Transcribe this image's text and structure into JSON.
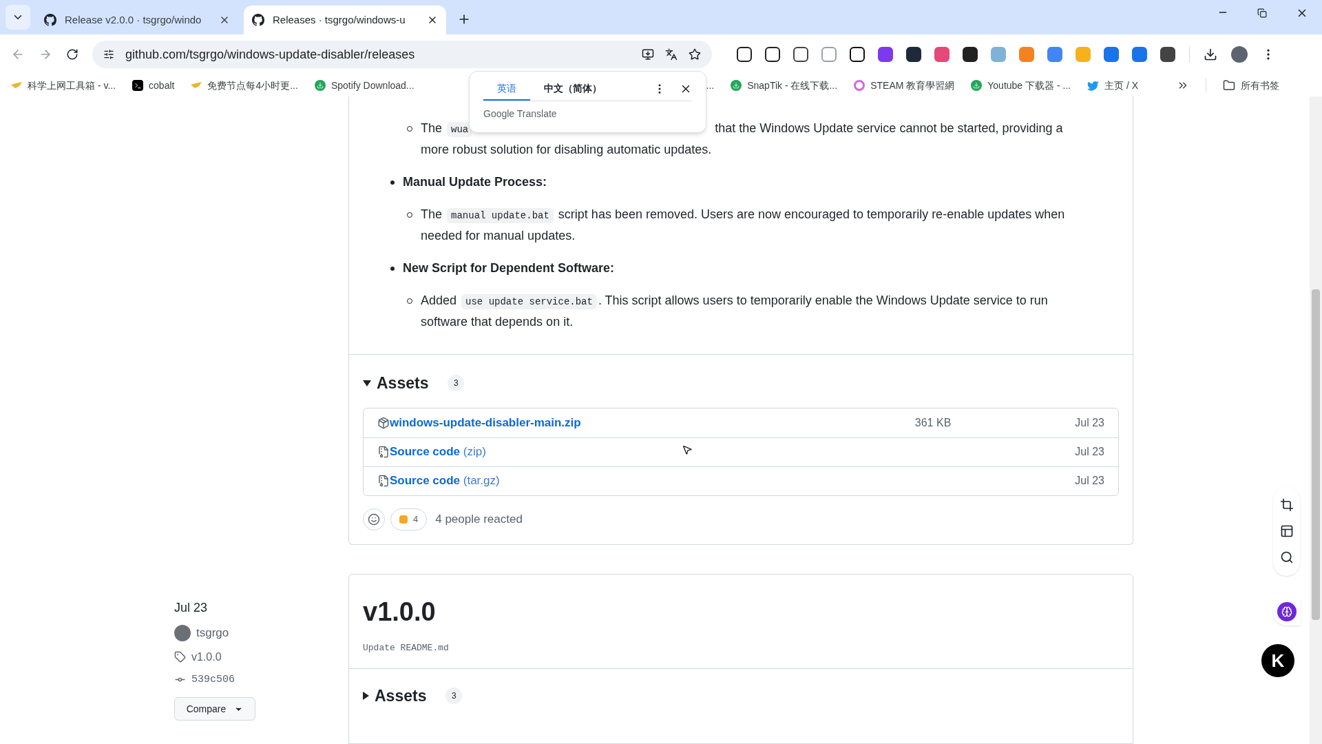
{
  "tabs": [
    {
      "title": "Release v2.0.0 · tsgrgo/windo",
      "selected": false
    },
    {
      "title": "Releases · tsgrgo/windows-u",
      "selected": true
    }
  ],
  "address": {
    "url": "github.com/tsgrgo/windows-update-disabler/releases"
  },
  "bookmarks": [
    {
      "label": "科学上网工具箱 - v...",
      "kind": "folder"
    },
    {
      "label": "cobalt",
      "kind": "terminal"
    },
    {
      "label": "免费节点每4小时更...",
      "kind": "folder"
    },
    {
      "label": "Spotify Download...",
      "kind": "download"
    },
    {
      "label": "...",
      "kind": "none"
    },
    {
      "label": "SnapTik - 在线下载...",
      "kind": "download"
    },
    {
      "label": "STEAM 教育學習網",
      "kind": "ring"
    },
    {
      "label": "Youtube 下载器 - ...",
      "kind": "download"
    },
    {
      "label": "主页 / X",
      "kind": "bird"
    }
  ],
  "all_bookmarks": "所有书签",
  "translate_popup": {
    "languages": [
      {
        "label": "英语",
        "selected": true
      },
      {
        "label": "中文（简体）",
        "selected": false
      }
    ],
    "brand": "Google Translate"
  },
  "notes": [
    {
      "items": [
        [
          {
            "kind": "text",
            "text": "The "
          },
          {
            "kind": "code",
            "text": "wua"
          },
          {
            "kind": "gap",
            "text": " that the Windows Update service cannot be started, providing a"
          },
          {
            "kind": "break",
            "text": "more robust solution for disabling automatic updates."
          }
        ]
      ]
    },
    {
      "heading": "Manual Update Process:",
      "items": [
        [
          {
            "kind": "text",
            "text": "The "
          },
          {
            "kind": "code",
            "text": "manual update.bat"
          },
          {
            "kind": "text",
            "text": " script has been removed. Users are now encouraged to temporarily re-enable updates when needed for manual updates."
          }
        ]
      ]
    },
    {
      "heading": "New Script for Dependent Software:",
      "items": [
        [
          {
            "kind": "text",
            "text": "Added "
          },
          {
            "kind": "code",
            "text": "use update service.bat"
          },
          {
            "kind": "text",
            "text": ". This script allows users to temporarily enable the Windows Update service to run software that depends on it."
          }
        ]
      ]
    }
  ],
  "assets": {
    "title": "Assets",
    "count": "3",
    "expanded": true,
    "files": [
      {
        "kind": "package",
        "name": "windows-update-disabler-main.zip",
        "size": "361 KB",
        "date": "Jul 23"
      },
      {
        "kind": "source",
        "name": "Source code",
        "suffix": "(zip)",
        "date": "Jul 23"
      },
      {
        "kind": "source",
        "name": "Source code",
        "suffix": "(tar.gz)",
        "date": "Jul 23"
      }
    ]
  },
  "reactions": {
    "thumbs_count": "4",
    "summary": "4 people reacted"
  },
  "release": {
    "date": "Jul 23",
    "author": "tsgrgo",
    "tag": "v1.0.0",
    "commit": "539c506",
    "compare": "Compare",
    "title": "v1.0.0",
    "message": "Update README.md",
    "assets": {
      "title": "Assets",
      "count": "3",
      "expanded": false
    }
  },
  "floating_badge": "K"
}
